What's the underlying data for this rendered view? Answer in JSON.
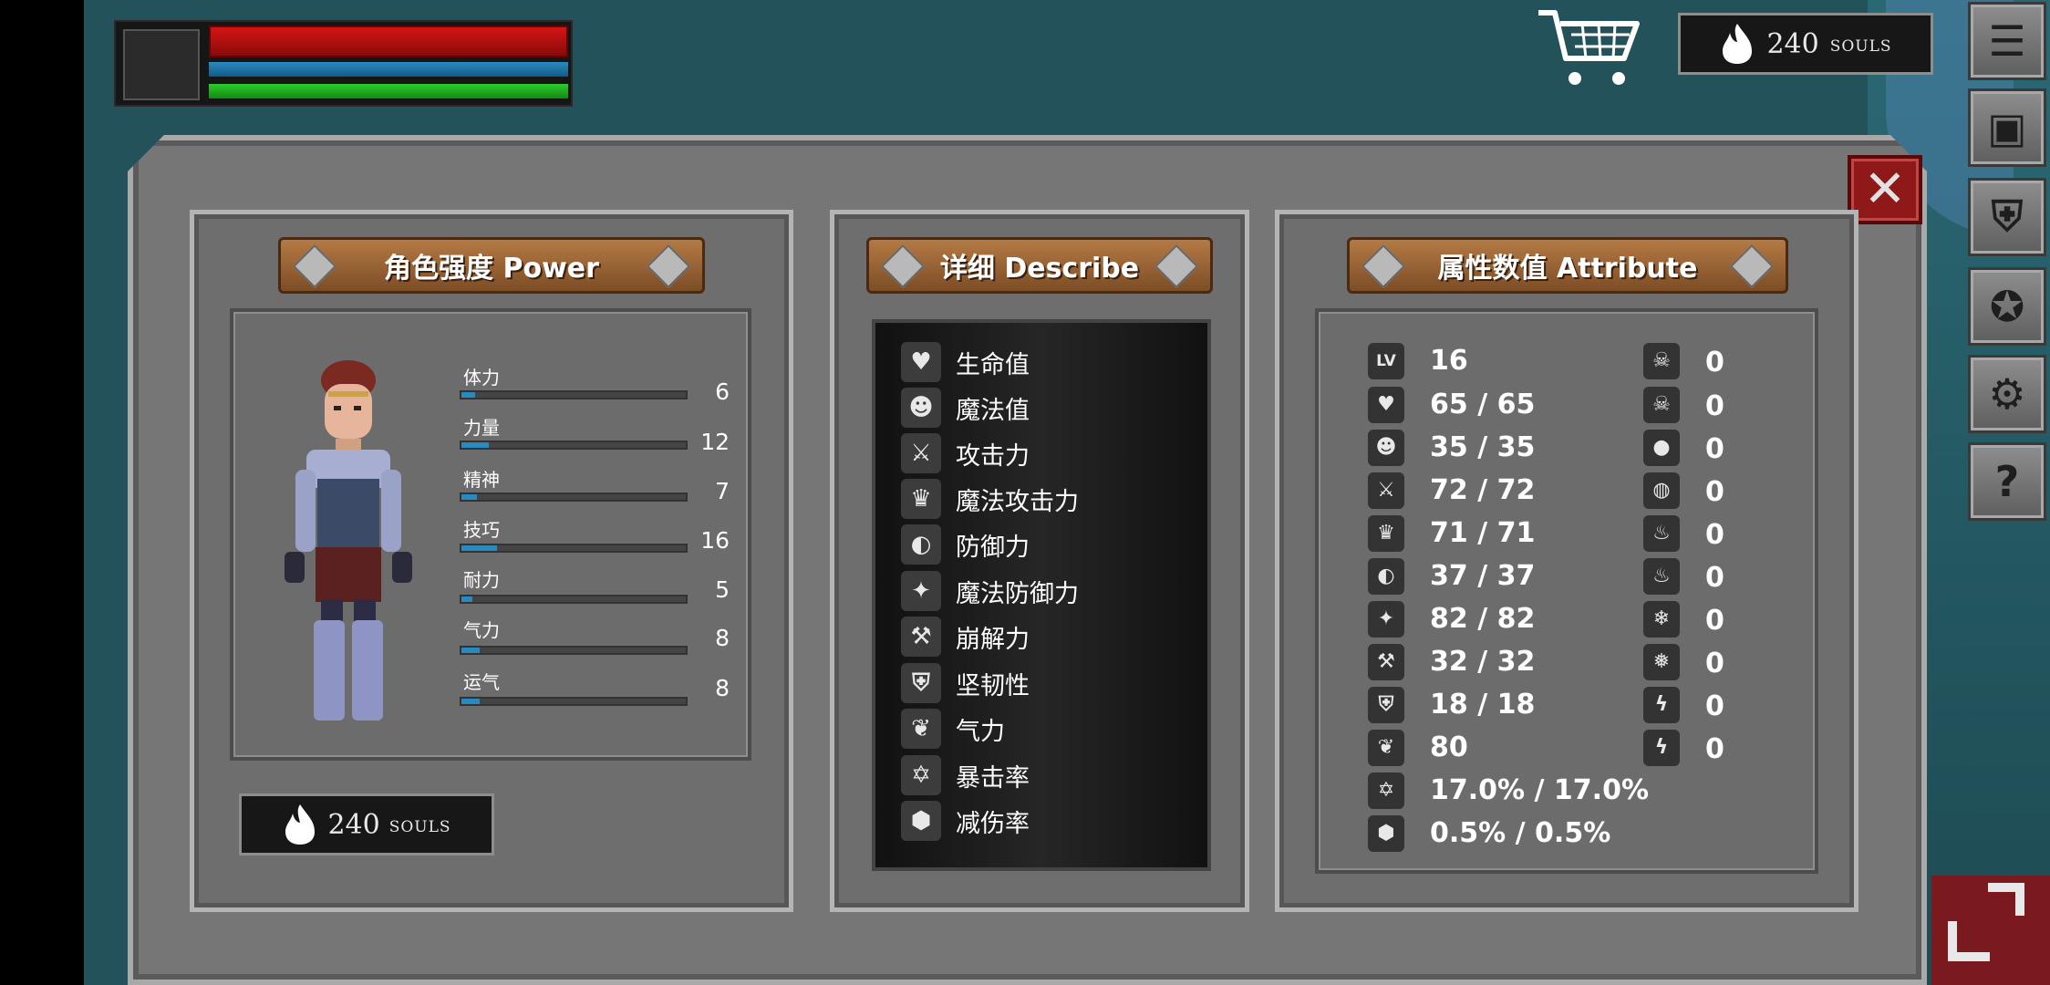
{
  "hud": {
    "health_fraction": 1.0,
    "mana_fraction": 1.0,
    "stamina_fraction": 1.0
  },
  "top_souls": {
    "value": "240",
    "label": "SOULS"
  },
  "side_buttons": [
    {
      "name": "menu-list-icon",
      "glyph": "☰"
    },
    {
      "name": "inventory-icon",
      "glyph": "▣"
    },
    {
      "name": "helmet-icon",
      "glyph": "⛨"
    },
    {
      "name": "skills-icon",
      "glyph": "✪"
    },
    {
      "name": "settings-gear-icon",
      "glyph": "⚙"
    },
    {
      "name": "help-icon",
      "glyph": "?"
    }
  ],
  "power": {
    "title": "角色强度 Power",
    "stats": [
      {
        "label": "体力",
        "value": "6",
        "fill": 0.06
      },
      {
        "label": "力量",
        "value": "12",
        "fill": 0.12
      },
      {
        "label": "精神",
        "value": "7",
        "fill": 0.07
      },
      {
        "label": "技巧",
        "value": "16",
        "fill": 0.16
      },
      {
        "label": "耐力",
        "value": "5",
        "fill": 0.05
      },
      {
        "label": "气力",
        "value": "8",
        "fill": 0.08
      },
      {
        "label": "运气",
        "value": "8",
        "fill": 0.08
      }
    ],
    "souls": {
      "value": "240",
      "label": "SOULS"
    }
  },
  "describe": {
    "title": "详细 Describe",
    "items": [
      {
        "icon": "heart-icon",
        "glyph": "♥",
        "label": "生命值"
      },
      {
        "icon": "head-mind-icon",
        "glyph": "☻",
        "label": "魔法值"
      },
      {
        "icon": "sword-icon",
        "glyph": "⚔",
        "label": "攻击力"
      },
      {
        "icon": "magic-book-icon",
        "glyph": "♛",
        "label": "魔法攻击力"
      },
      {
        "icon": "shield-icon",
        "glyph": "◐",
        "label": "防御力"
      },
      {
        "icon": "magic-shield-icon",
        "glyph": "✦",
        "label": "魔法防御力"
      },
      {
        "icon": "break-hammer-icon",
        "glyph": "⚒",
        "label": "崩解力"
      },
      {
        "icon": "knight-helmet-icon",
        "glyph": "⛨",
        "label": "坚韧性"
      },
      {
        "icon": "lungs-icon",
        "glyph": "❦",
        "label": "气力"
      },
      {
        "icon": "critical-star-icon",
        "glyph": "✡",
        "label": "暴击率"
      },
      {
        "icon": "damage-reduce-icon",
        "glyph": "⬢",
        "label": "减伤率"
      }
    ]
  },
  "attribute": {
    "title": "属性数值 Attribute",
    "left": [
      {
        "icon": "level-icon",
        "glyph": "LV",
        "value": "16"
      },
      {
        "icon": "heart-icon",
        "glyph": "♥",
        "value": "65 / 65"
      },
      {
        "icon": "head-mind-icon",
        "glyph": "☻",
        "value": "35 / 35"
      },
      {
        "icon": "sword-icon",
        "glyph": "⚔",
        "value": "72 / 72"
      },
      {
        "icon": "magic-book-icon",
        "glyph": "♛",
        "value": "71 / 71"
      },
      {
        "icon": "shield-icon",
        "glyph": "◐",
        "value": "37 / 37"
      },
      {
        "icon": "magic-shield-icon",
        "glyph": "✦",
        "value": "82 / 82"
      },
      {
        "icon": "break-hammer-icon",
        "glyph": "⚒",
        "value": "32 / 32"
      },
      {
        "icon": "knight-helmet-icon",
        "glyph": "⛨",
        "value": "18 / 18"
      },
      {
        "icon": "lungs-icon",
        "glyph": "❦",
        "value": "80"
      },
      {
        "icon": "critical-star-icon",
        "glyph": "✡",
        "value": "17.0% / 17.0%"
      },
      {
        "icon": "damage-reduce-icon",
        "glyph": "⬢",
        "value": "0.5% / 0.5%"
      }
    ],
    "right": [
      {
        "icon": "skull-poison-icon",
        "glyph": "☠",
        "value": "0"
      },
      {
        "icon": "skull-resist-icon",
        "glyph": "☠",
        "value": "0"
      },
      {
        "icon": "blood-drop-icon",
        "glyph": "●",
        "value": "0"
      },
      {
        "icon": "bleed-resist-icon",
        "glyph": "◍",
        "value": "0"
      },
      {
        "icon": "fire-icon",
        "glyph": "♨",
        "value": "0"
      },
      {
        "icon": "fire-resist-icon",
        "glyph": "♨",
        "value": "0"
      },
      {
        "icon": "frost-icon",
        "glyph": "❄",
        "value": "0"
      },
      {
        "icon": "frost-resist-icon",
        "glyph": "❅",
        "value": "0"
      },
      {
        "icon": "lightning-icon",
        "glyph": "ϟ",
        "value": "0"
      },
      {
        "icon": "lightning-resist-icon",
        "glyph": "ϟ",
        "value": "0"
      }
    ]
  },
  "colors": {
    "panel": "#767676",
    "plank": "#9c6535",
    "close": "#8f1818",
    "stat_fill": "#2a8ac0"
  }
}
